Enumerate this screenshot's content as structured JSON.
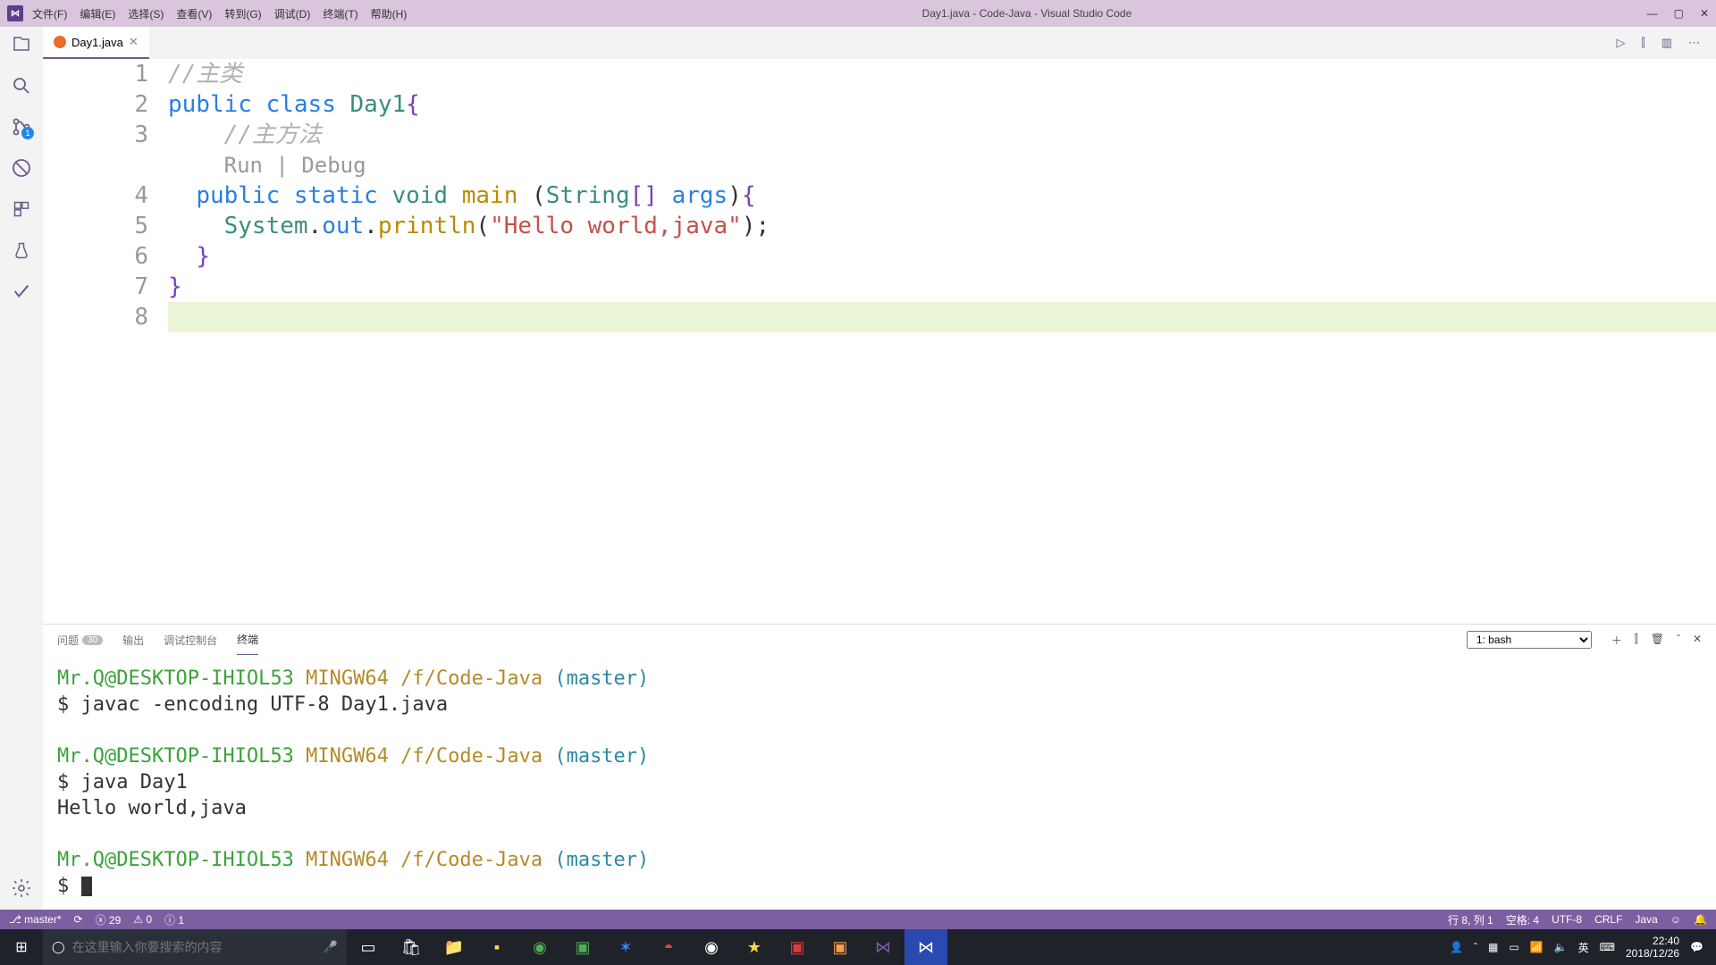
{
  "titlebar": {
    "logo_text": "⋈",
    "menus": [
      "文件(F)",
      "编辑(E)",
      "选择(S)",
      "查看(V)",
      "转到(G)",
      "调试(D)",
      "终端(T)",
      "帮助(H)"
    ],
    "title": "Day1.java - Code-Java - Visual Studio Code",
    "min": "—",
    "max": "▢",
    "close": "✕"
  },
  "activity": {
    "scm_badge": "1"
  },
  "tab": {
    "filename": "Day1.java",
    "close": "✕"
  },
  "tab_actions": {
    "run": "▷",
    "split": "⫿",
    "layout": "▥",
    "more": "⋯"
  },
  "code": {
    "lines": [
      {
        "n": "1",
        "html": "<span class='c-comment'>//主类</span>"
      },
      {
        "n": "2",
        "html": "<span class='c-key'>public</span> <span class='c-key'>class</span> <span class='c-cls'>Day1</span><span class='c-brk'>{</span>"
      },
      {
        "n": "3",
        "html": "    <span class='c-comment'>//主方法</span>"
      },
      {
        "n": "",
        "html": "    <span class='c-lens'>Run | Debug</span>"
      },
      {
        "n": "4",
        "html": "  <span class='c-key'>public</span> <span class='c-key'>static</span> <span class='c-type'>void</span> <span class='c-func'>main</span> <span class='c-pun'>(</span><span class='c-cls'>String</span><span class='c-brk'>[]</span> <span class='c-var'>args</span><span class='c-pun'>)</span><span class='c-brk'>{</span>"
      },
      {
        "n": "5",
        "html": "    <span class='c-cls'>System</span><span class='c-pun'>.</span><span class='c-var'>out</span><span class='c-pun'>.</span><span class='c-func'>println</span><span class='c-pun'>(</span><span class='c-str'>\"Hello world,java\"</span><span class='c-pun'>);</span>"
      },
      {
        "n": "6",
        "html": "  <span class='c-brk'>}</span>"
      },
      {
        "n": "7",
        "html": "<span class='c-brk'>}</span>"
      },
      {
        "n": "8",
        "html": "",
        "hl": true
      }
    ]
  },
  "panel": {
    "tabs": {
      "problems": "问题",
      "problems_count": "30",
      "output": "输出",
      "debug_console": "调试控制台",
      "terminal": "终端"
    },
    "term_option": "1: bash",
    "actions": {
      "new": "＋",
      "split": "⫿",
      "trash": "🗑",
      "up": "ˆ",
      "close": "✕"
    }
  },
  "terminal": {
    "prompt_user": "Mr.Q@DESKTOP-IHIOL53",
    "prompt_host": "MINGW64",
    "prompt_path": "/f/Code-Java",
    "prompt_branch": "(master)",
    "cmd1": "$ javac -encoding UTF-8 Day1.java",
    "cmd2": "$ java Day1",
    "out1": "Hello world,java",
    "prompt_sym": "$ "
  },
  "status": {
    "branch": "⎇ master*",
    "sync": "⟳",
    "errors": "ⓧ 29",
    "warnings": "⚠ 0",
    "info": "ⓘ 1",
    "ln_col": "行 8,  列 1",
    "spaces": "空格: 4",
    "encoding": "UTF-8",
    "eol": "CRLF",
    "lang": "Java",
    "feedback": "☺",
    "bell": "🔔"
  },
  "taskbar": {
    "search_placeholder": "在这里输入你要搜索的内容",
    "clock_time": "22:40",
    "clock_date": "2018/12/26"
  }
}
